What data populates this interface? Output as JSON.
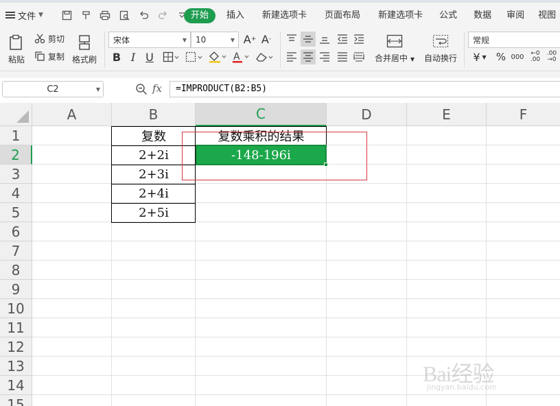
{
  "menubar": {
    "file_label": "文件",
    "tabs": [
      "开始",
      "插入",
      "新建选项卡",
      "页面布局",
      "新建选项卡",
      "公式",
      "数据",
      "审阅",
      "视图"
    ],
    "active_tab": "开始"
  },
  "ribbon": {
    "paste_label": "粘贴",
    "cut_label": "剪切",
    "copy_label": "复制",
    "format_painter_label": "格式刷",
    "font_name": "宋体",
    "font_size": "10",
    "merge_center_label": "合并居中",
    "wrap_text_label": "自动换行",
    "number_format": "常规",
    "bold": "B",
    "italic": "I",
    "underline": "U"
  },
  "formula_bar": {
    "name_box": "C2",
    "fx_label": "fx",
    "formula": "=IMPRODUCT(B2:B5)"
  },
  "sheet": {
    "columns": [
      "A",
      "B",
      "C",
      "D",
      "E",
      "F"
    ],
    "rows": [
      "1",
      "2",
      "3",
      "4",
      "5",
      "6",
      "7",
      "8",
      "9",
      "10",
      "11",
      "12",
      "13",
      "14",
      "15"
    ],
    "active_column": "C",
    "active_row": "2",
    "cells": {
      "B1": "复数",
      "B2": "2+2i",
      "B3": "2+3i",
      "B4": "2+4i",
      "B5": "2+5i",
      "C1": "复数乘积的结果",
      "C2": "-148-196i"
    }
  },
  "watermark": {
    "brand": "Bai经验",
    "site": "jingyan.baidu.com"
  },
  "colors": {
    "accent": "#1e9d4f",
    "active_cell": "#1ba84a",
    "highlight_box": "#d9363e"
  }
}
